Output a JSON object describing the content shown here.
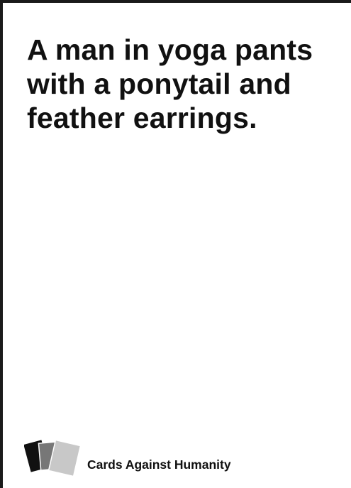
{
  "card": {
    "text": "A man in yoga pants with a ponytail and feather earrings.",
    "brand": "Cards Against Humanity"
  },
  "logo": {
    "icon": "stacked-cards-icon",
    "colors": [
      "#111111",
      "#7a7a7a",
      "#c8c8c8"
    ]
  }
}
